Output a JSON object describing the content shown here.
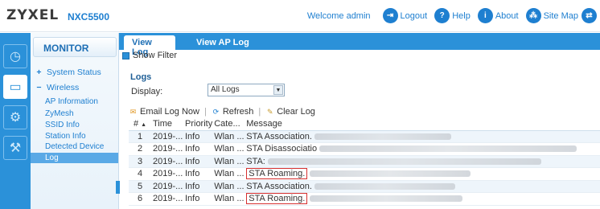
{
  "header": {
    "brand": "ZYXEL",
    "model": "NXC5500",
    "welcome": "Welcome admin",
    "links": [
      {
        "label": "Logout",
        "icon": "logout-icon"
      },
      {
        "label": "Help",
        "icon": "help-icon"
      },
      {
        "label": "About",
        "icon": "about-icon"
      },
      {
        "label": "Site Map",
        "icon": "sitemap-icon"
      }
    ]
  },
  "sidebar": {
    "title": "MONITOR",
    "items": [
      {
        "label": "System Status",
        "expander": "+"
      },
      {
        "label": "Wireless",
        "expander": "−"
      }
    ],
    "subitems": [
      "AP Information",
      "ZyMesh",
      "SSID Info",
      "Station Info",
      "Detected Device",
      "Log"
    ],
    "selected": "Log"
  },
  "tabs": [
    {
      "label": "View Log",
      "active": true
    },
    {
      "label": "View AP Log",
      "active": false
    }
  ],
  "filter": {
    "label": "Show Filter"
  },
  "logs": {
    "title": "Logs",
    "display_label": "Display:",
    "display_value": "All Logs",
    "toolbar": {
      "email": "Email Log Now",
      "refresh": "Refresh",
      "clear": "Clear Log"
    },
    "columns": [
      "#",
      "Time",
      "Priority",
      "Cate...",
      "Message"
    ],
    "rows": [
      {
        "num": "1",
        "time": "2019-...",
        "priority": "Info",
        "category": "Wlan ...",
        "message": "STA Association.",
        "highlight": false
      },
      {
        "num": "2",
        "time": "2019-...",
        "priority": "Info",
        "category": "Wlan ...",
        "message": "STA Disassociatio",
        "highlight": false
      },
      {
        "num": "3",
        "time": "2019-...",
        "priority": "Info",
        "category": "Wlan ...",
        "message": "STA:",
        "highlight": false
      },
      {
        "num": "4",
        "time": "2019-...",
        "priority": "Info",
        "category": "Wlan ...",
        "message": "STA Roaming.",
        "highlight": true
      },
      {
        "num": "5",
        "time": "2019-...",
        "priority": "Info",
        "category": "Wlan ...",
        "message": "STA Association.",
        "highlight": false
      },
      {
        "num": "6",
        "time": "2019-...",
        "priority": "Info",
        "category": "Wlan ...",
        "message": "STA Roaming.",
        "highlight": true
      }
    ]
  },
  "colors": {
    "accent": "#2b91d9",
    "link": "#1e7fd0",
    "highlight_border": "#d63030"
  }
}
